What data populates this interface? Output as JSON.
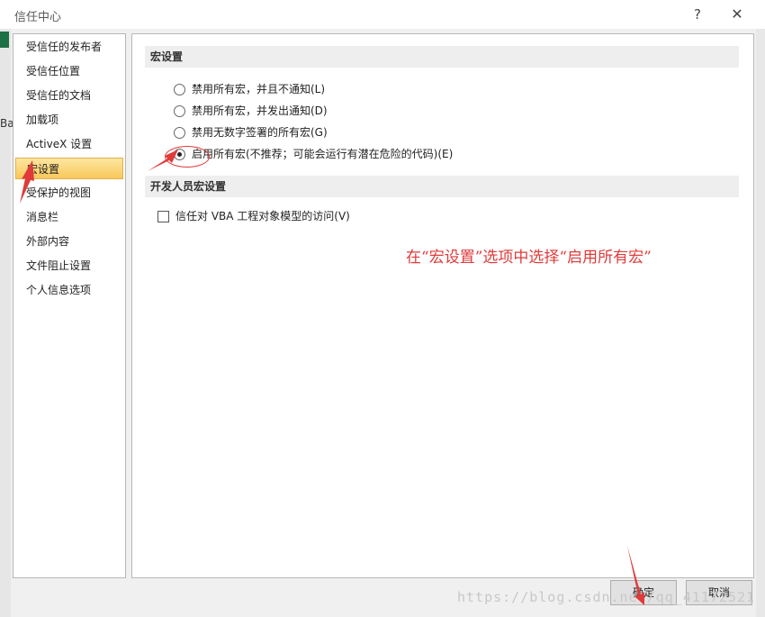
{
  "window": {
    "title": "信任中心",
    "help_label": "?",
    "close_label": "✕"
  },
  "sidebar": {
    "items": [
      {
        "label": "受信任的发布者"
      },
      {
        "label": "受信任位置"
      },
      {
        "label": "受信任的文档"
      },
      {
        "label": "加载项"
      },
      {
        "label": "ActiveX 设置"
      },
      {
        "label": "宏设置"
      },
      {
        "label": "受保护的视图"
      },
      {
        "label": "消息栏"
      },
      {
        "label": "外部内容"
      },
      {
        "label": "文件阻止设置"
      },
      {
        "label": "个人信息选项"
      }
    ],
    "selected": "宏设置"
  },
  "macro_settings": {
    "heading": "宏设置",
    "options": [
      {
        "label": "禁用所有宏，并且不通知(L)",
        "checked": false
      },
      {
        "label": "禁用所有宏，并发出通知(D)",
        "checked": false
      },
      {
        "label": "禁用无数字签署的所有宏(G)",
        "checked": false
      },
      {
        "label": "启用所有宏(不推荐；可能会运行有潜在危险的代码)(E)",
        "checked": true
      }
    ]
  },
  "developer_settings": {
    "heading": "开发人员宏设置",
    "vba_access_label": "信任对 VBA 工程对象模型的访问(V)",
    "vba_access_checked": false
  },
  "annotation": {
    "text": "在“宏设置”选项中选择“启用所有宏”",
    "color": "#e03a3a"
  },
  "buttons": {
    "ok_label": "确定",
    "cancel_label": "取消"
  },
  "background": {
    "fragment_text": "Ba"
  },
  "watermark": "https://blog.csdn.net/qq_41172521"
}
